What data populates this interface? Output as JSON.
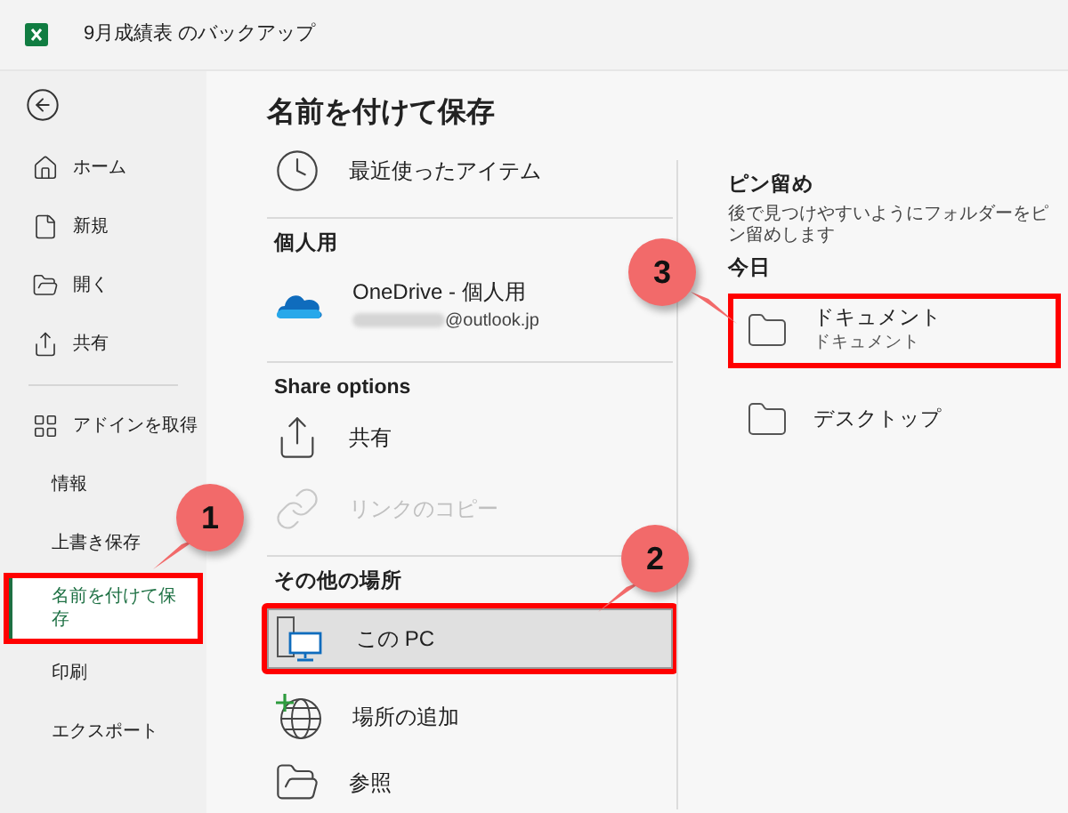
{
  "window": {
    "title": "9月成績表 のバックアップ"
  },
  "sidebar": {
    "items": [
      {
        "kind": "home",
        "label": "ホーム",
        "selected": false,
        "highlighted": false
      },
      {
        "kind": "new",
        "label": "新規",
        "selected": false,
        "highlighted": false
      },
      {
        "kind": "open",
        "label": "開く",
        "selected": false,
        "highlighted": false
      },
      {
        "kind": "share",
        "label": "共有",
        "selected": false,
        "highlighted": false
      },
      {
        "kind": "divider"
      },
      {
        "kind": "addins",
        "label": "アドインを取得",
        "selected": false,
        "highlighted": false
      },
      {
        "kind": "text",
        "label": "情報",
        "selected": false,
        "highlighted": false
      },
      {
        "kind": "text",
        "label": "上書き保存",
        "selected": false,
        "highlighted": false
      },
      {
        "kind": "text",
        "label": "名前を付けて保存",
        "selected": true,
        "highlighted": true
      },
      {
        "kind": "text",
        "label": "印刷",
        "selected": false,
        "highlighted": false
      },
      {
        "kind": "text",
        "label": "エクスポート",
        "selected": false,
        "highlighted": false
      }
    ]
  },
  "save_as": {
    "title": "名前を付けて保存",
    "recent": {
      "label": "最近使ったアイテム"
    },
    "groups": [
      {
        "header": "個人用",
        "items": [
          {
            "kind": "onedrive",
            "label": "OneDrive - 個人用",
            "sublabel": "@outlook.jp",
            "selected": false,
            "disabled": false,
            "highlighted": false
          }
        ]
      },
      {
        "header": "Share options",
        "items": [
          {
            "kind": "share",
            "label": "共有",
            "selected": false,
            "disabled": false,
            "highlighted": false
          },
          {
            "kind": "link",
            "label": "リンクのコピー",
            "selected": false,
            "disabled": true,
            "highlighted": false
          }
        ]
      },
      {
        "header": "その他の場所",
        "items": [
          {
            "kind": "pc",
            "label": "この PC",
            "selected": true,
            "disabled": false,
            "highlighted": true
          },
          {
            "kind": "globe",
            "label": "場所の追加",
            "selected": false,
            "disabled": false,
            "highlighted": false
          },
          {
            "kind": "browse",
            "label": "参照",
            "selected": false,
            "disabled": false,
            "highlighted": false
          }
        ]
      }
    ]
  },
  "pinned": {
    "title": "ピン留め",
    "description": "後で見つけやすいようにフォルダーをピン留めします",
    "group": "今日",
    "folders": [
      {
        "name": "ドキュメント",
        "path": "ドキュメント",
        "highlighted": true
      },
      {
        "name": "デスクトップ",
        "highlighted": false
      }
    ]
  },
  "callouts": [
    {
      "number": "1"
    },
    {
      "number": "2"
    },
    {
      "number": "3"
    }
  ]
}
